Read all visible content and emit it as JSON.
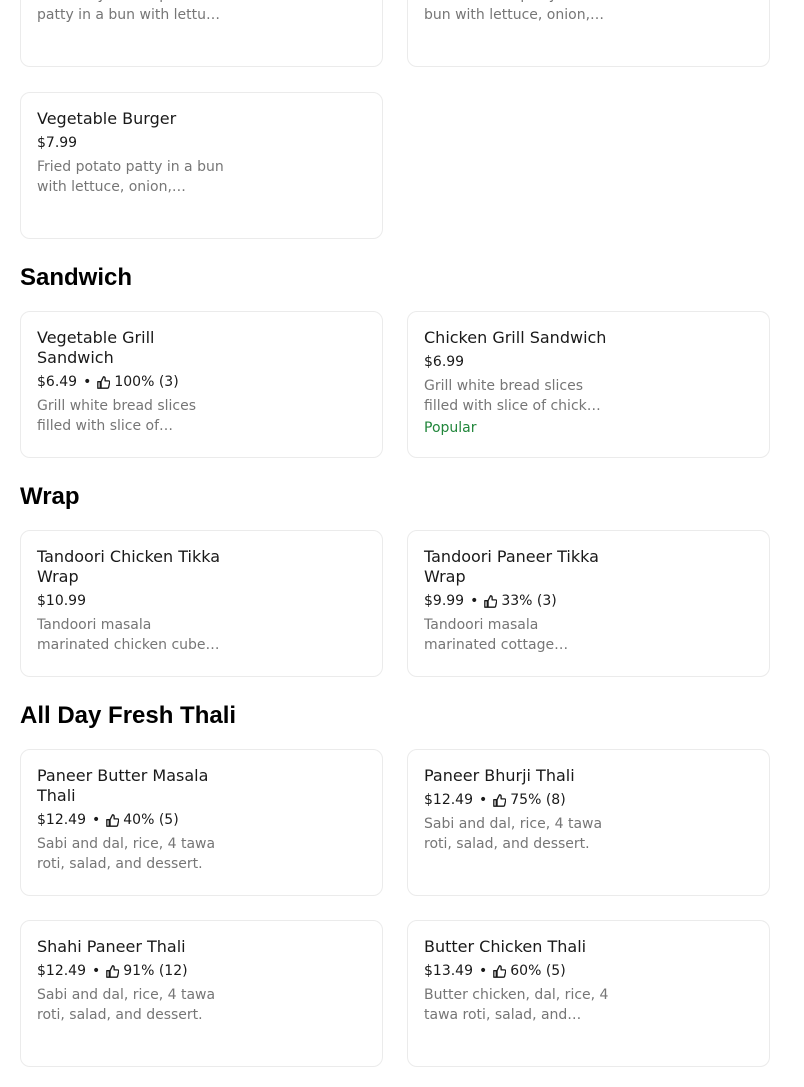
{
  "top_cards": [
    {
      "desc": "Indian style fried potato patty in a bun with lettuce, onion,…"
    },
    {
      "desc": "Fried chicken patty in a bun with lettuce, onion,…"
    }
  ],
  "veg_burger": {
    "name": "Vegetable Burger",
    "price": "$7.99",
    "desc": "Fried potato patty in a bun with lettuce, onion,…"
  },
  "sections": {
    "sandwich": "Sandwich",
    "wrap": "Wrap",
    "thali": "All Day Fresh Thali"
  },
  "sandwich_items": [
    {
      "name": "Vegetable Grill Sandwich",
      "price": "$6.49",
      "rating": "100% (3)",
      "desc": "Grill white bread slices filled with slice of…"
    },
    {
      "name": "Chicken Grill Sandwich",
      "price": "$6.99",
      "desc": "Grill white bread slices filled with slice of chick…",
      "badge": "Popular"
    }
  ],
  "wrap_items": [
    {
      "name": "Tandoori Chicken Tikka Wrap",
      "price": "$10.99",
      "desc": "Tandoori masala marinated chicken cube…"
    },
    {
      "name": "Tandoori Paneer Tikka Wrap",
      "price": "$9.99",
      "rating": "33% (3)",
      "desc": "Tandoori masala marinated cottage…"
    }
  ],
  "thali_items": [
    {
      "name": "Paneer Butter Masala Thali",
      "price": "$12.49",
      "rating": "40% (5)",
      "desc": "Sabi and dal, rice, 4 tawa roti, salad, and dessert."
    },
    {
      "name": "Paneer Bhurji Thali",
      "price": "$12.49",
      "rating": "75% (8)",
      "desc": "Sabi and dal, rice, 4 tawa roti, salad, and dessert."
    },
    {
      "name": "Shahi Paneer Thali",
      "price": "$12.49",
      "rating": "91% (12)",
      "desc": "Sabi and dal, rice, 4 tawa roti, salad, and dessert."
    },
    {
      "name": "Butter Chicken Thali",
      "price": "$13.49",
      "rating": "60% (5)",
      "desc": "Butter chicken, dal, rice, 4 tawa roti, salad, and…"
    }
  ],
  "separator": "•",
  "icons": {
    "rating": "thumbs-up-icon"
  },
  "colors": {
    "popular": "#21863b",
    "muted": "#767676"
  }
}
